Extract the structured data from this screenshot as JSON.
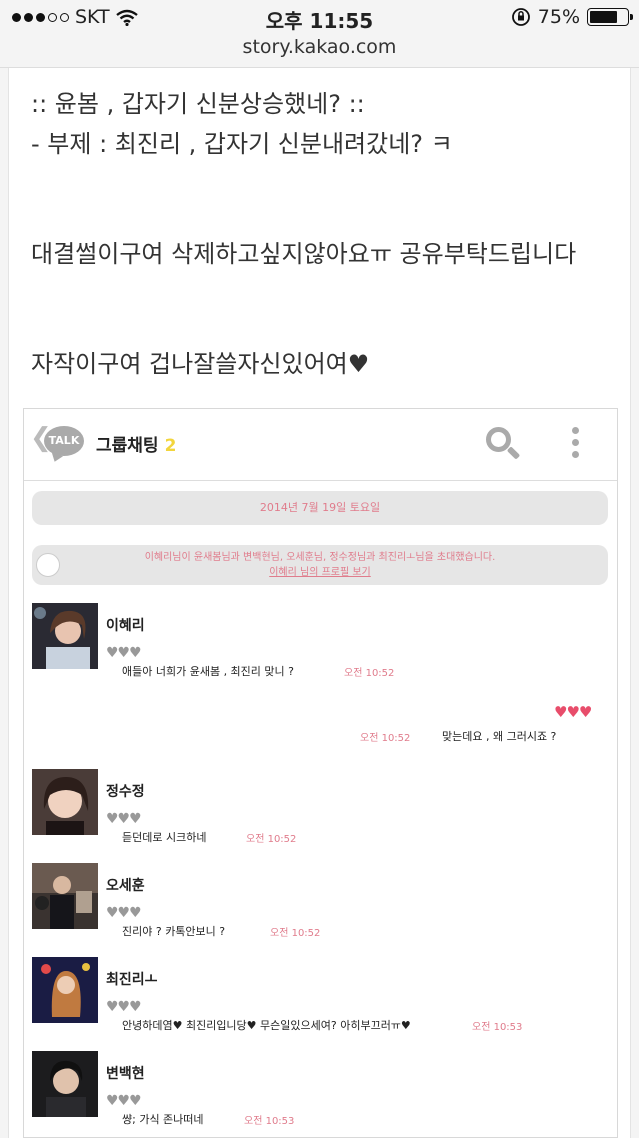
{
  "status_bar": {
    "carrier": "SKT",
    "time": "오후 11:55",
    "battery": "75%",
    "battery_level": 0.75,
    "signal_bars_filled": 3,
    "signal_bars_total": 5
  },
  "url": "story.kakao.com",
  "post": {
    "line1": ":: 윤봄 , 갑자기 신분상승했네? ::",
    "line2": "- 부제 : 최진리 , 갑자기 신분내려갔네? ㅋ",
    "line3": "대결썰이구여 삭제하고싶지않아요ㅠ 공유부탁드립니다",
    "line4": "자작이구여 겁나잘쓸자신있어여",
    "heart": "♥"
  },
  "chat": {
    "talk_logo": "TALK",
    "title": "그룹채팅",
    "member_count": "2",
    "date": "2014년 7월 19일 토요일",
    "system_msg": "이혜리님이 윤새봄님과 변백현님, 오세훈님, 정수정님과 최진리ㅗ님을 초대했습니다.",
    "system_link": "이혜리 님의 프로필 보기",
    "gray_hearts": "♥♥♥",
    "red_hearts": "♥♥♥",
    "messages": [
      {
        "name": "이혜리",
        "text": "애들아 너희가 윤새봄 , 최진리 맞니 ?",
        "time": "오전 10:52"
      },
      {
        "mine": true,
        "text": "맞는데요 , 왜 그러시죠 ?",
        "time": "오전 10:52"
      },
      {
        "name": "정수정",
        "text": "듣던데로 시크하네",
        "time": "오전 10:52"
      },
      {
        "name": "오세훈",
        "text": "진리야 ? 카톡안보니 ?",
        "time": "오전 10:52"
      },
      {
        "name": "최진리ㅗ",
        "text": "안녕하데염♥ 최진리입니당♥ 무슨일있으세여? 아히부끄러ㅠ♥",
        "time": "오전 10:53"
      },
      {
        "name": "변백현",
        "text": "썅; 가식 존나떠네",
        "time": "오전 10:53"
      }
    ]
  },
  "colors": {
    "accent_pink": "#e07c8c",
    "heart_red": "#e84d6b",
    "kakao_yellow": "#f2d53c"
  }
}
